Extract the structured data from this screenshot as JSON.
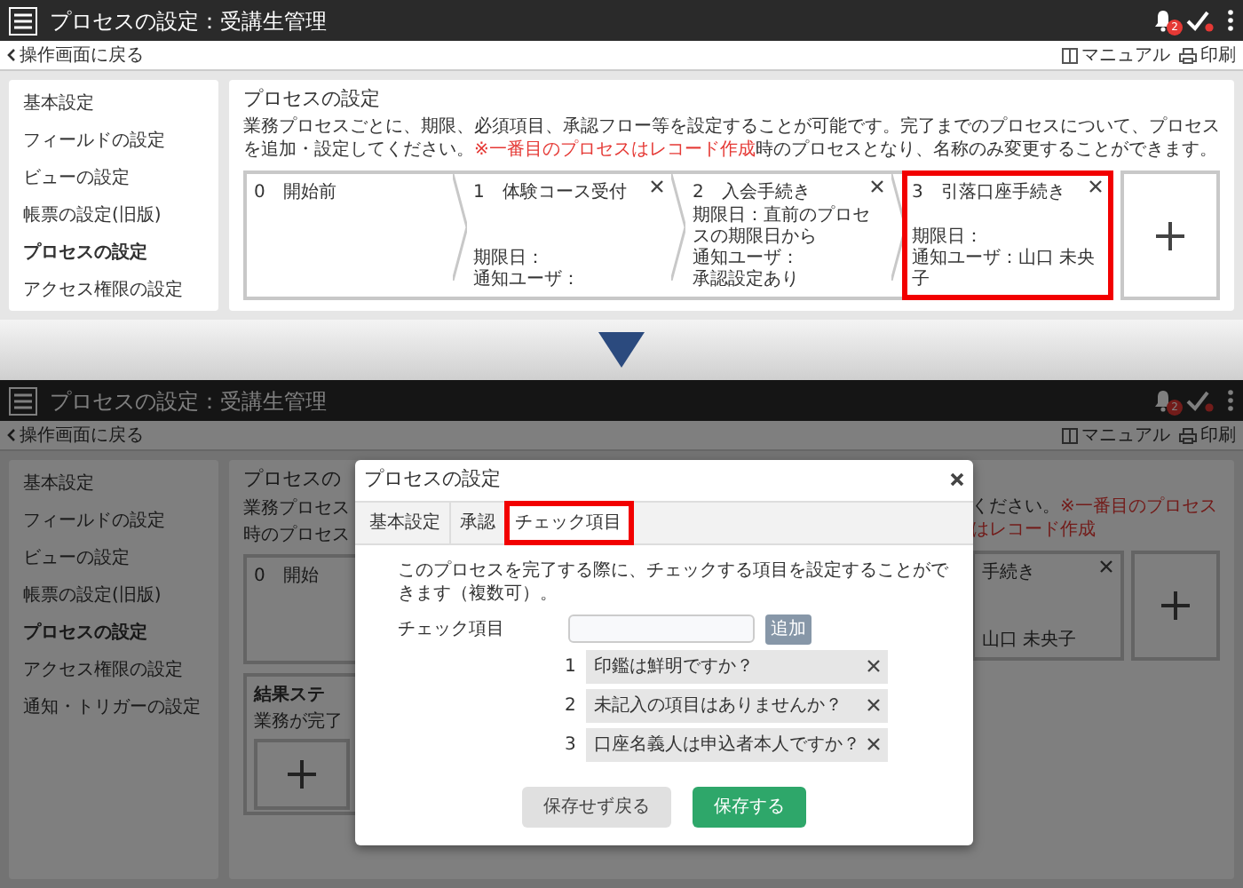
{
  "top": {
    "header": {
      "title": "プロセスの設定：受講生管理",
      "notification_count": "2"
    },
    "toolbar": {
      "back": "操作画面に戻る",
      "manual": "マニュアル",
      "print": "印刷"
    },
    "sidebar": {
      "items": [
        {
          "label": "基本設定",
          "selected": false
        },
        {
          "label": "フィールドの設定",
          "selected": false
        },
        {
          "label": "ビューの設定",
          "selected": false
        },
        {
          "label": "帳票の設定(旧版)",
          "selected": false
        },
        {
          "label": "プロセスの設定",
          "selected": true
        },
        {
          "label": "アクセス権限の設定",
          "selected": false
        }
      ]
    },
    "main": {
      "heading": "プロセスの設定",
      "description": "業務プロセスごとに、期限、必須項目、承認フロー等を設定することが可能です。完了までのプロセスについて、プロセスを追加・設定してください。",
      "note": "※一番目のプロセスはレコード作成",
      "description_end": "時のプロセスとなり、名称のみ変更することができます。",
      "processes": [
        {
          "number": "0",
          "name": "開始前",
          "removable": false,
          "highlighted": false
        },
        {
          "number": "1",
          "name": "体験コース受付",
          "removable": true,
          "highlighted": false,
          "details": [
            "期限日：",
            "通知ユーザ："
          ]
        },
        {
          "number": "2",
          "name": "入会手続き",
          "removable": true,
          "highlighted": false,
          "details": [
            "期限日：直前のプロセスの期限日から",
            "通知ユーザ：",
            "承認設定あり"
          ]
        },
        {
          "number": "3",
          "name": "引落口座手続き",
          "removable": true,
          "highlighted": true,
          "details": [
            "期限日：",
            "通知ユーザ：山口 未央子"
          ]
        }
      ]
    }
  },
  "bottom": {
    "header": {
      "title": "プロセスの設定：受講生管理",
      "notification_count": "2"
    },
    "toolbar": {
      "back": "操作画面に戻る",
      "manual": "マニュアル",
      "print": "印刷"
    },
    "sidebar": {
      "items": [
        {
          "label": "基本設定",
          "selected": false
        },
        {
          "label": "フィールドの設定",
          "selected": false
        },
        {
          "label": "ビューの設定",
          "selected": false
        },
        {
          "label": "帳票の設定(旧版)",
          "selected": false
        },
        {
          "label": "プロセスの設定",
          "selected": true
        },
        {
          "label": "アクセス権限の設定",
          "selected": false
        },
        {
          "label": "通知・トリガーの設定",
          "selected": false
        }
      ]
    },
    "main_left": {
      "heading": "プロセスの",
      "description_lines": [
        "業務プロセス",
        "時のプロセス"
      ],
      "first_step": {
        "number": "0",
        "name": "開始"
      },
      "section_heading": "結果ステ",
      "section_text": "業務が完了"
    },
    "main_right": {
      "description": "ください。",
      "note": "※一番目のプロセスはレコード作成",
      "last_step": {
        "name": "手続き",
        "detail": "山口 未央子"
      }
    },
    "modal": {
      "title": "プロセスの設定",
      "tabs": [
        {
          "label": "基本設定",
          "selected": false,
          "highlighted": false
        },
        {
          "label": "承認",
          "selected": false,
          "highlighted": false
        },
        {
          "label": "チェック項目",
          "selected": true,
          "highlighted": true
        }
      ],
      "instruction": "このプロセスを完了する際に、チェックする項目を設定することができます（複数可）。",
      "field_label": "チェック項目",
      "add_button": "追加",
      "items": [
        {
          "number": "1",
          "text": "印鑑は鮮明ですか？"
        },
        {
          "number": "2",
          "text": "未記入の項目はありませんか？"
        },
        {
          "number": "3",
          "text": "口座名義人は申込者本人ですか？"
        }
      ],
      "buttons": [
        {
          "label": "保存せず戻る",
          "kind": "secondary"
        },
        {
          "label": "保存する",
          "kind": "primary"
        }
      ]
    }
  }
}
